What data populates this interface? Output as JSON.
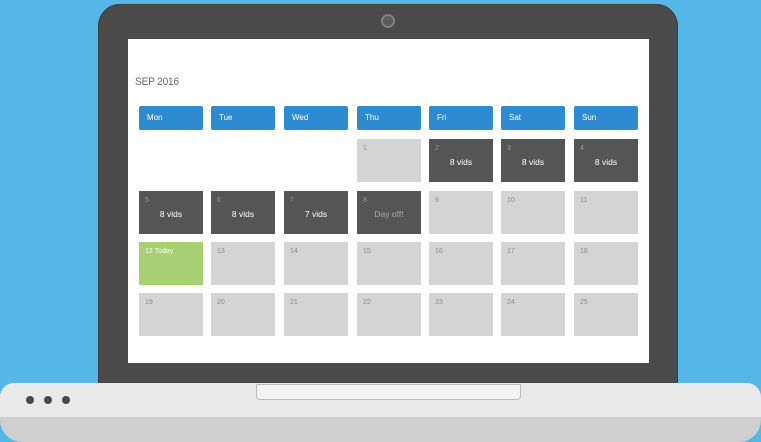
{
  "calendar": {
    "month_title": "SEP 2016",
    "day_headers": [
      "Mon",
      "Tue",
      "Wed",
      "Thu",
      "Fri",
      "Sat",
      "Sun"
    ],
    "weeks": [
      [
        {
          "day": "",
          "label": "",
          "state": "empty"
        },
        {
          "day": "",
          "label": "",
          "state": "empty"
        },
        {
          "day": "",
          "label": "",
          "state": "empty"
        },
        {
          "day": "1",
          "label": "",
          "state": "normal"
        },
        {
          "day": "2",
          "label": "8 vids",
          "state": "dark"
        },
        {
          "day": "3",
          "label": "8 vids",
          "state": "dark"
        },
        {
          "day": "4",
          "label": "8 vids",
          "state": "dark"
        }
      ],
      [
        {
          "day": "5",
          "label": "8 vids",
          "state": "dark"
        },
        {
          "day": "6",
          "label": "8 vids",
          "state": "dark"
        },
        {
          "day": "7",
          "label": "7 vids",
          "state": "dark"
        },
        {
          "day": "8",
          "label": "Day off!",
          "state": "dark-off"
        },
        {
          "day": "9",
          "label": "",
          "state": "normal"
        },
        {
          "day": "10",
          "label": "",
          "state": "normal"
        },
        {
          "day": "11",
          "label": "",
          "state": "normal"
        }
      ],
      [
        {
          "day": "12 Today",
          "label": "",
          "state": "today"
        },
        {
          "day": "13",
          "label": "",
          "state": "normal"
        },
        {
          "day": "14",
          "label": "",
          "state": "normal"
        },
        {
          "day": "15",
          "label": "",
          "state": "normal"
        },
        {
          "day": "16",
          "label": "",
          "state": "normal"
        },
        {
          "day": "17",
          "label": "",
          "state": "normal"
        },
        {
          "day": "18",
          "label": "",
          "state": "normal"
        }
      ],
      [
        {
          "day": "19",
          "label": "",
          "state": "normal"
        },
        {
          "day": "20",
          "label": "",
          "state": "normal"
        },
        {
          "day": "21",
          "label": "",
          "state": "normal"
        },
        {
          "day": "22",
          "label": "",
          "state": "normal"
        },
        {
          "day": "23",
          "label": "",
          "state": "normal"
        },
        {
          "day": "24",
          "label": "",
          "state": "normal"
        },
        {
          "day": "25",
          "label": "",
          "state": "normal"
        }
      ]
    ]
  },
  "colors": {
    "background": "#55b6e8",
    "header": "#2f8bd1",
    "dark_cell": "#555555",
    "normal_cell": "#d4d4d4",
    "today_cell": "#a7cf73"
  }
}
